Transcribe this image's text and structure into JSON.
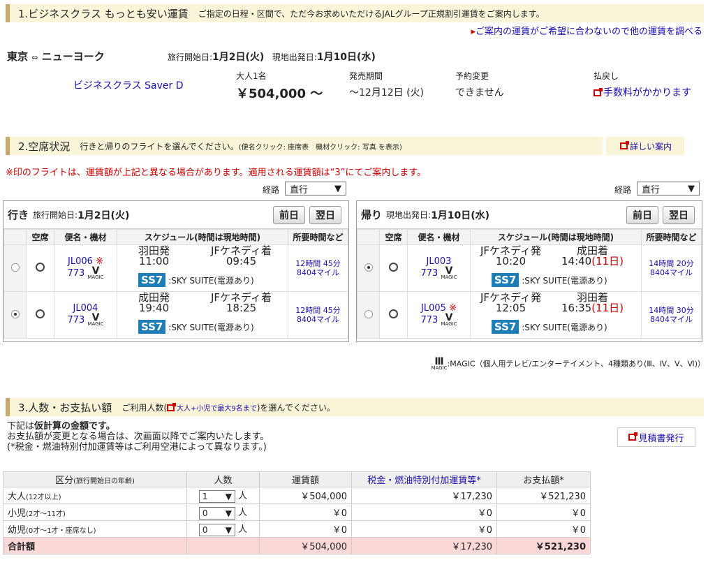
{
  "section1": {
    "title": "1.ビジネスクラス もっとも安い運賃",
    "desc": "ご指定の日程・区間で、ただ今お求めいただけるJALグループ正規割引運賃をご案内します。",
    "other_fares_link": "ご案内の運賃がご希望に合わないので他の運賃を調べる"
  },
  "route": {
    "from": "東京",
    "to": "ニューヨーク",
    "depart_label": "旅行開始日:",
    "depart_date": "1月2日(火)",
    "return_label": "現地出発日:",
    "return_date": "1月10日(水)"
  },
  "fare": {
    "name": "ビジネスクラス Saver D",
    "pax_label": "大人1名",
    "price": "￥504,000 ～",
    "sale_label": "発売期間",
    "sale_value": "～12月12日 (火)",
    "change_label": "予約変更",
    "change_value": "できません",
    "refund_label": "払戻し",
    "refund_value": "手数料がかかります"
  },
  "section2": {
    "title": "2.空席状況",
    "desc": "行きと帰りのフライトを選んでください。",
    "desc_small": "(便名クリック: 座席表　機材クリック: 写真 を表示)",
    "detail_link": "詳しい案内",
    "notice": "※印のフライトは、運賃額が上記と異なる場合があります。適用される運賃額は“3”にてご案内します。"
  },
  "route_select": {
    "label": "経路",
    "value": "直行"
  },
  "outbound": {
    "label": "行き",
    "date_label": "旅行開始日:",
    "date": "1月2日(火)",
    "prev": "前日",
    "next": "翌日",
    "headers": [
      "空席",
      "便名・機材",
      "スケジュール(時間は現地時間)",
      "所要時間など"
    ],
    "flights": [
      {
        "no": "JL006",
        "mark": "※",
        "aircraft": "773",
        "dep_port": "羽田発",
        "dep_time": "11:00",
        "arr_port": "JFケネディ着",
        "arr_time": "09:45",
        "arr_extra": "",
        "seat": "SKY SUITE(電源あり)",
        "duration": "12時間 45分",
        "miles": "8404マイル",
        "selected": false
      },
      {
        "no": "JL004",
        "mark": "",
        "aircraft": "773",
        "dep_port": "成田発",
        "dep_time": "19:40",
        "arr_port": "JFケネディ着",
        "arr_time": "18:25",
        "arr_extra": "",
        "seat": "SKY SUITE(電源あり)",
        "duration": "12時間 45分",
        "miles": "8404マイル",
        "selected": true
      }
    ]
  },
  "inbound": {
    "label": "帰り",
    "date_label": "現地出発日:",
    "date": "1月10日(水)",
    "prev": "前日",
    "next": "翌日",
    "headers": [
      "空席",
      "便名・機材",
      "スケジュール(時間は現地時間)",
      "所要時間など"
    ],
    "flights": [
      {
        "no": "JL003",
        "mark": "",
        "aircraft": "773",
        "dep_port": "JFケネディ発",
        "dep_time": "10:20",
        "arr_port": "成田着",
        "arr_time": "14:40",
        "arr_extra": "(11日)",
        "seat": "SKY SUITE(電源あり)",
        "duration": "14時間 20分",
        "miles": "8404マイル",
        "selected": true
      },
      {
        "no": "JL005",
        "mark": "※",
        "aircraft": "773",
        "dep_port": "JFケネディ発",
        "dep_time": "12:05",
        "arr_port": "羽田着",
        "arr_time": "16:35",
        "arr_extra": "(11日)",
        "seat": "SKY SUITE(電源あり)",
        "duration": "14時間 30分",
        "miles": "8404マイル",
        "selected": false
      }
    ]
  },
  "ss7": "SS7",
  "magic_label": "MAGIC",
  "magic_roman": "Ⅴ",
  "magic_legend": ":MAGIC（個人用テレビ/エンターテイメント、4種類あり(Ⅲ、Ⅳ、Ⅴ、Ⅵ)）",
  "section3": {
    "title": "3.人数・お支払い額",
    "desc_pre": "ご利用人数(",
    "desc_link": "大人+小児で最大9名まで",
    "desc_post": ")を選んでください。",
    "note1_pre": "下記は",
    "note1_bold": "仮計算の金額です。",
    "note2": "お支払額が変更となる場合は、次画面以降でご案内いたします。",
    "note3": "(*税金・燃油特別付加運賃等はご利用空港によって異なります。)",
    "estimate_button": "見積書発行"
  },
  "payment_table": {
    "headers": [
      "区分",
      "(旅行開始日の年齢)",
      "人数",
      "運賃額",
      "税金・燃油特別付加運賃等*",
      "お支払額*"
    ],
    "rows": [
      {
        "cat": "大人",
        "cat_sub": "(12才以上)",
        "count": "1",
        "unit": "人",
        "fare": "￥504,000",
        "tax": "￥17,230",
        "total": "￥521,230"
      },
      {
        "cat": "小児",
        "cat_sub": "(2才～11才)",
        "count": "0",
        "unit": "人",
        "fare": "￥0",
        "tax": "￥0",
        "total": "￥0"
      },
      {
        "cat": "幼児",
        "cat_sub": "(0才～1才・座席なし)",
        "count": "0",
        "unit": "人",
        "fare": "￥0",
        "tax": "￥0",
        "total": "￥0"
      }
    ],
    "total_row": {
      "label": "合計額",
      "fare": "￥504,000",
      "tax": "￥17,230",
      "total": "￥521,230"
    }
  }
}
